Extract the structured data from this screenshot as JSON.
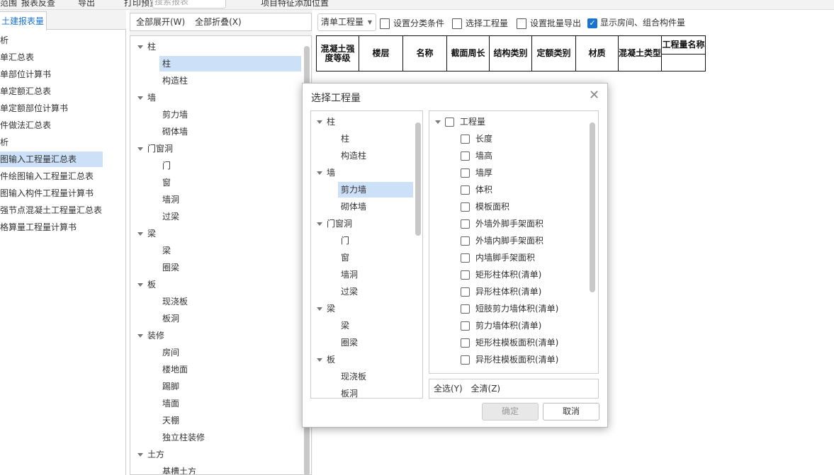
{
  "toolbar": {
    "items": [
      "范围",
      "报表反查",
      "导出",
      "打印预览"
    ],
    "search_placeholder": "搜索报表",
    "position_select": "项目特征添加位置"
  },
  "left": {
    "tab": "土建报表量",
    "items": [
      "分析",
      "清单汇总表",
      "清单部位计算书",
      "清单定额汇总表",
      "清单定额部位计算书",
      "构件做法汇总表",
      "分析",
      "绘图输入工程量汇总表",
      "构件绘图输入工程量汇总表",
      "绘图输入构件工程量计算书",
      "钢筋节点混凝土工程量汇总表",
      "表格算量工程量计算书"
    ],
    "display": [
      "析",
      "单汇总表",
      "单部位计算书",
      "单定额汇总表",
      "单定额部位计算书",
      "件做法汇总表",
      "析",
      "图输入工程量汇总表",
      "件绘图输入工程量汇总表",
      "图输入构件工程量计算书",
      "强节点混凝土工程量汇总表",
      "格算量工程量计算书"
    ],
    "selected_index": 7
  },
  "middle": {
    "expand_all": "全部展开(W)",
    "collapse_all": "全部折叠(X)",
    "tree": [
      {
        "label": "柱",
        "level": 0
      },
      {
        "label": "柱",
        "level": 1,
        "selected": true
      },
      {
        "label": "构造柱",
        "level": 1
      },
      {
        "label": "墙",
        "level": 0
      },
      {
        "label": "剪力墙",
        "level": 1
      },
      {
        "label": "砌体墙",
        "level": 1
      },
      {
        "label": "门窗洞",
        "level": 0
      },
      {
        "label": "门",
        "level": 1
      },
      {
        "label": "窗",
        "level": 1
      },
      {
        "label": "墙洞",
        "level": 1
      },
      {
        "label": "过梁",
        "level": 1
      },
      {
        "label": "梁",
        "level": 0
      },
      {
        "label": "梁",
        "level": 1
      },
      {
        "label": "圈梁",
        "level": 1
      },
      {
        "label": "板",
        "level": 0
      },
      {
        "label": "现浇板",
        "level": 1
      },
      {
        "label": "板洞",
        "level": 1
      },
      {
        "label": "装修",
        "level": 0
      },
      {
        "label": "房间",
        "level": 1
      },
      {
        "label": "楼地面",
        "level": 1
      },
      {
        "label": "踢脚",
        "level": 1
      },
      {
        "label": "墙面",
        "level": 1
      },
      {
        "label": "天棚",
        "level": 1
      },
      {
        "label": "独立柱装修",
        "level": 1
      },
      {
        "label": "土方",
        "level": 0
      },
      {
        "label": "基槽土方",
        "level": 1
      }
    ]
  },
  "report": {
    "combo": "清单工程量",
    "set_category": "设置分类条件",
    "select_quantity": "选择工程量",
    "batch_export": "设置批量导出",
    "show_rooms": "显示房间、组合构件量",
    "show_rooms_checked": true,
    "columns": [
      "混凝土强度等级",
      "楼层",
      "名称",
      "截面周长",
      "结构类别",
      "定额类别",
      "材质",
      "混凝土类型",
      "工程量名称"
    ]
  },
  "dialog": {
    "title": "选择工程量",
    "tree": [
      {
        "label": "柱",
        "level": 0
      },
      {
        "label": "柱",
        "level": 1
      },
      {
        "label": "构造柱",
        "level": 1
      },
      {
        "label": "墙",
        "level": 0
      },
      {
        "label": "剪力墙",
        "level": 1,
        "selected": true
      },
      {
        "label": "砌体墙",
        "level": 1
      },
      {
        "label": "门窗洞",
        "level": 0
      },
      {
        "label": "门",
        "level": 1
      },
      {
        "label": "窗",
        "level": 1
      },
      {
        "label": "墙洞",
        "level": 1
      },
      {
        "label": "过梁",
        "level": 1
      },
      {
        "label": "梁",
        "level": 0
      },
      {
        "label": "梁",
        "level": 1
      },
      {
        "label": "圈梁",
        "level": 1
      },
      {
        "label": "板",
        "level": 0
      },
      {
        "label": "现浇板",
        "level": 1
      },
      {
        "label": "板洞",
        "level": 1
      }
    ],
    "quantity_root": "工程量",
    "quantities": [
      "长度",
      "墙高",
      "墙厚",
      "体积",
      "模板面积",
      "外墙外脚手架面积",
      "外墙内脚手架面积",
      "内墙脚手架面积",
      "矩形柱体积(清单)",
      "异形柱体积(清单)",
      "短肢剪力墙体积(清单)",
      "剪力墙体积(清单)",
      "矩形柱模板面积(清单)",
      "异形柱模板面积(清单)"
    ],
    "select_all": "全选(Y)",
    "clear_all": "全清(Z)",
    "ok": "确定",
    "cancel": "取消"
  }
}
